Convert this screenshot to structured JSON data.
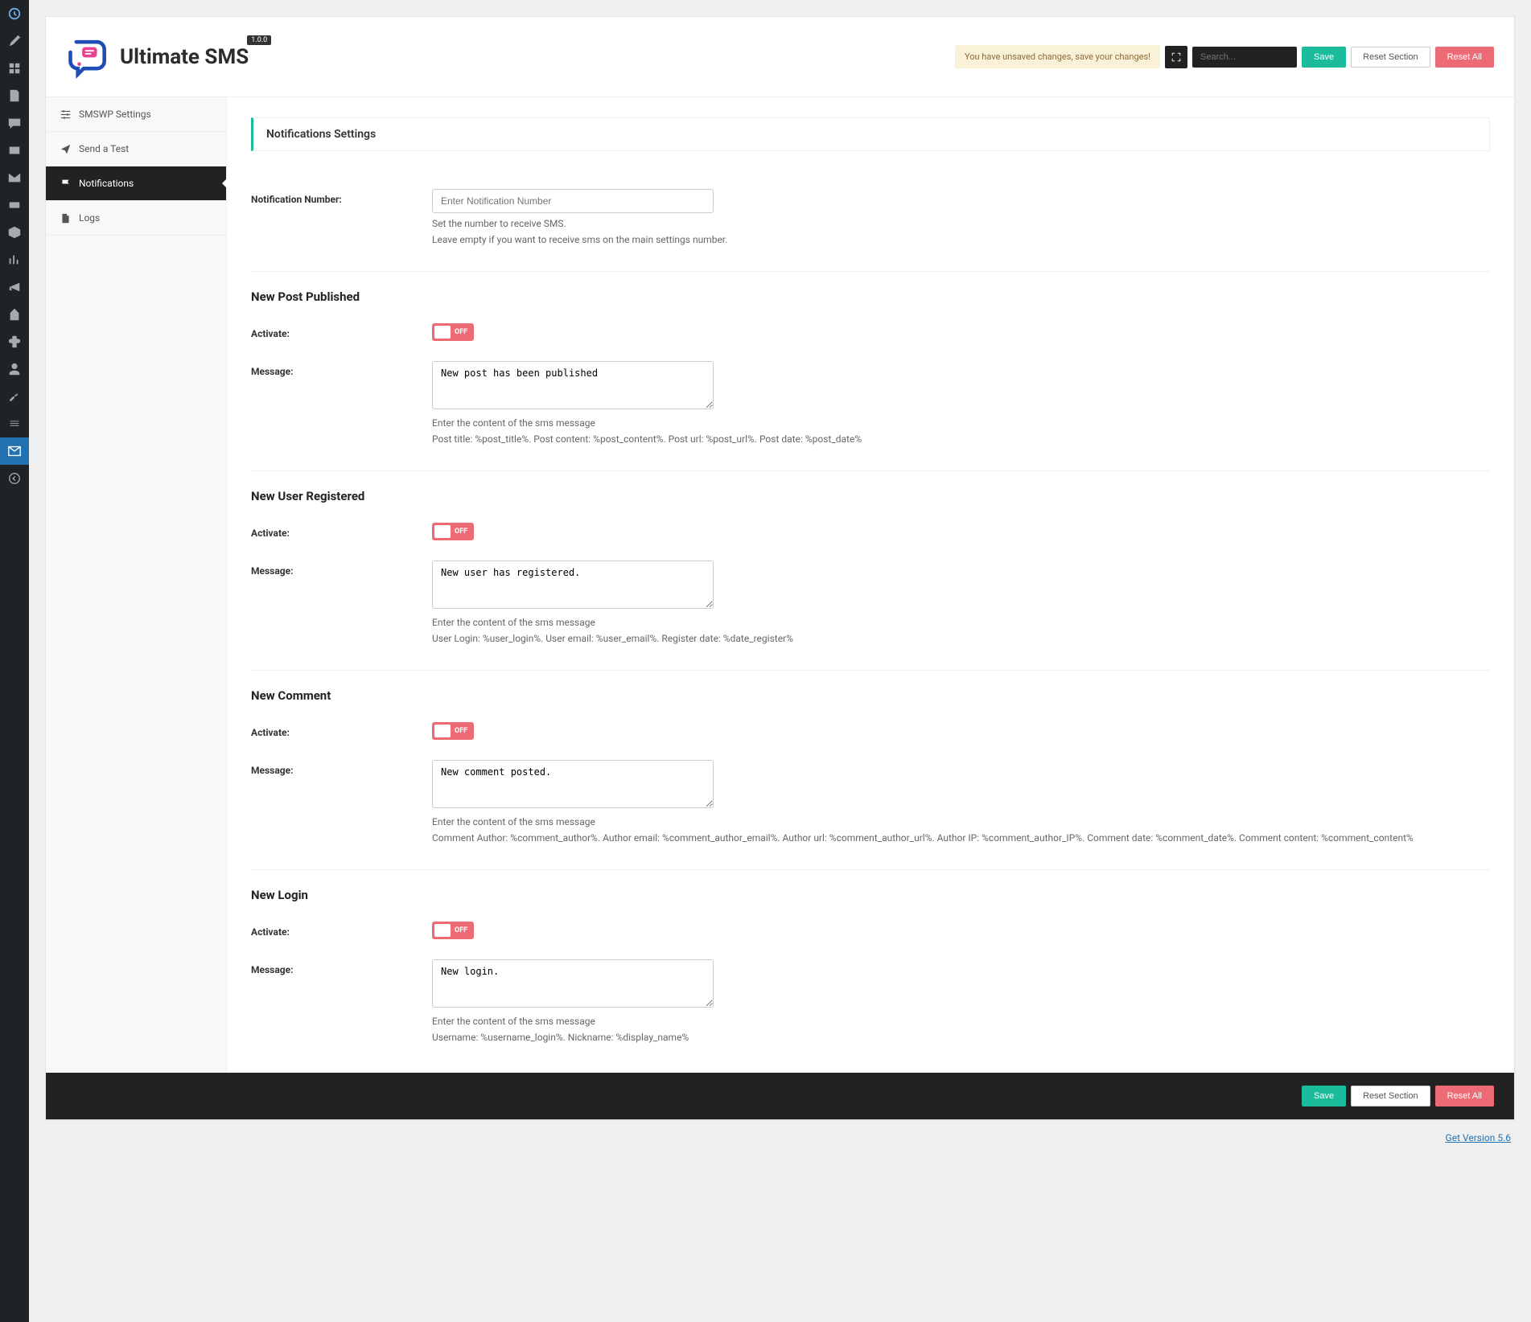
{
  "brand": {
    "title": "Ultimate SMS",
    "version": "1.0.0"
  },
  "header": {
    "unsaved_notice": "You have unsaved changes, save your changes!",
    "search_placeholder": "Search...",
    "save": "Save",
    "reset_section": "Reset Section",
    "reset_all": "Reset All"
  },
  "sidebar": {
    "items": [
      {
        "label": "SMSWP Settings"
      },
      {
        "label": "Send a Test"
      },
      {
        "label": "Notifications"
      },
      {
        "label": "Logs"
      }
    ]
  },
  "content": {
    "page_title": "Notifications Settings",
    "notification_number": {
      "label": "Notification Number:",
      "placeholder": "Enter Notification Number",
      "help1": "Set the number to receive SMS.",
      "help2": "Leave empty if you want to receive sms on the main settings number."
    },
    "sections": [
      {
        "title": "New Post Published",
        "activate_label": "Activate:",
        "toggle_state": "OFF",
        "message_label": "Message:",
        "message_value": "New post has been published",
        "help1": "Enter the content of the sms message",
        "help2": "Post title: %post_title%. Post content: %post_content%. Post url: %post_url%. Post date: %post_date%"
      },
      {
        "title": "New User Registered",
        "activate_label": "Activate:",
        "toggle_state": "OFF",
        "message_label": "Message:",
        "message_value": "New user has registered.",
        "help1": "Enter the content of the sms message",
        "help2": "User Login: %user_login%. User email: %user_email%. Register date: %date_register%"
      },
      {
        "title": "New Comment",
        "activate_label": "Activate:",
        "toggle_state": "OFF",
        "message_label": "Message:",
        "message_value": "New comment posted.",
        "help1": "Enter the content of the sms message",
        "help2": "Comment Author: %comment_author%. Author email: %comment_author_email%. Author url: %comment_author_url%. Author IP: %comment_author_IP%. Comment date: %comment_date%. Comment content: %comment_content%"
      },
      {
        "title": "New Login",
        "activate_label": "Activate:",
        "toggle_state": "OFF",
        "message_label": "Message:",
        "message_value": "New login.",
        "help1": "Enter the content of the sms message",
        "help2": "Username: %username_login%. Nickname: %display_name%"
      }
    ]
  },
  "footer": {
    "save": "Save",
    "reset_section": "Reset Section",
    "reset_all": "Reset All"
  },
  "bottom_link": "Get Version 5.6"
}
